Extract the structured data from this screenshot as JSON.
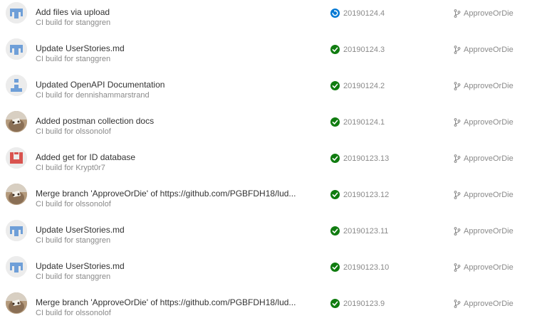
{
  "colors": {
    "success": "#107c10",
    "in_progress": "#0078d4",
    "title_text": "#333333",
    "secondary_text": "#8a8a8a",
    "avatar_blue": "#6f9fd8",
    "avatar_red": "#d9534f"
  },
  "builds": [
    {
      "title": "Add files via upload",
      "subtitle": "CI build for stanggren",
      "status": "in-progress",
      "status_icon": "in-progress-icon",
      "build_number": "20190124.4",
      "branch": "ApproveOrDie",
      "avatar": "identicon-blue"
    },
    {
      "title": "Update UserStories.md",
      "subtitle": "CI build for stanggren",
      "status": "succeeded",
      "status_icon": "checkmark-circle-icon",
      "build_number": "20190124.3",
      "branch": "ApproveOrDie",
      "avatar": "identicon-blue"
    },
    {
      "title": "Updated OpenAPI Documentation",
      "subtitle": "CI build for dennishammarstrand",
      "status": "succeeded",
      "status_icon": "checkmark-circle-icon",
      "build_number": "20190124.2",
      "branch": "ApproveOrDie",
      "avatar": "identicon-blue-sparse"
    },
    {
      "title": "Added postman collection docs",
      "subtitle": "CI build for olssonolof",
      "status": "succeeded",
      "status_icon": "checkmark-circle-icon",
      "build_number": "20190124.1",
      "branch": "ApproveOrDie",
      "avatar": "photo-cat"
    },
    {
      "title": "Added get for ID database",
      "subtitle": "CI build for Krypt0r7",
      "status": "succeeded",
      "status_icon": "checkmark-circle-icon",
      "build_number": "20190123.13",
      "branch": "ApproveOrDie",
      "avatar": "identicon-red"
    },
    {
      "title": "Merge branch 'ApproveOrDie' of https://github.com/PGBFDH18/lud...",
      "subtitle": "CI build for olssonolof",
      "status": "succeeded",
      "status_icon": "checkmark-circle-icon",
      "build_number": "20190123.12",
      "branch": "ApproveOrDie",
      "avatar": "photo-cat"
    },
    {
      "title": "Update UserStories.md",
      "subtitle": "CI build for stanggren",
      "status": "succeeded",
      "status_icon": "checkmark-circle-icon",
      "build_number": "20190123.11",
      "branch": "ApproveOrDie",
      "avatar": "identicon-blue"
    },
    {
      "title": "Update UserStories.md",
      "subtitle": "CI build for stanggren",
      "status": "succeeded",
      "status_icon": "checkmark-circle-icon",
      "build_number": "20190123.10",
      "branch": "ApproveOrDie",
      "avatar": "identicon-blue"
    },
    {
      "title": "Merge branch 'ApproveOrDie' of https://github.com/PGBFDH18/lud...",
      "subtitle": "CI build for olssonolof",
      "status": "succeeded",
      "status_icon": "checkmark-circle-icon",
      "build_number": "20190123.9",
      "branch": "ApproveOrDie",
      "avatar": "photo-cat"
    }
  ]
}
